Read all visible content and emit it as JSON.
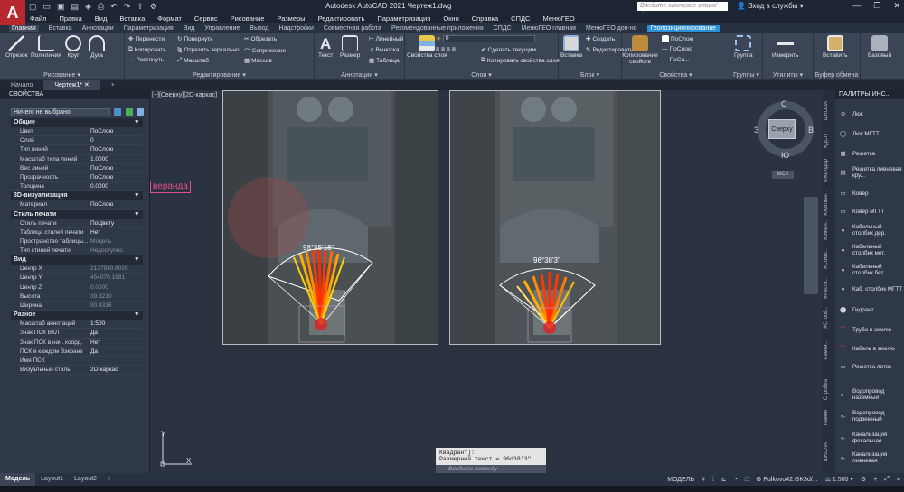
{
  "title_bar": {
    "logo_letter": "A",
    "window_title": "Autodesk AutoCAD 2021   Чертеж1.dwg",
    "search_placeholder": "Введите ключевое слово/фразу",
    "sign_in": "Вход в службы"
  },
  "menu": [
    "Файл",
    "Правка",
    "Вид",
    "Вставка",
    "Формат",
    "Сервис",
    "Рисование",
    "Размеры",
    "Редактировать",
    "Параметризация",
    "Окно",
    "Справка",
    "СПДС",
    "МенюГЕО"
  ],
  "ribbon_tabs": [
    "Главная",
    "Вставка",
    "Аннотации",
    "Параметризация",
    "Вид",
    "Управление",
    "Вывод",
    "Надстройки",
    "Совместная работа",
    "Рекомендованные приложения",
    "СПДС",
    "МенюГЕО главная",
    "МенюГЕО доп-но",
    "Геопозиционирование"
  ],
  "ribbon": {
    "draw": {
      "label": "Рисование",
      "buttons": [
        "Отрезок",
        "Полилиния",
        "Круг",
        "Дуга"
      ]
    },
    "modify": {
      "label": "Редактирование",
      "buttons": [
        "Перенести",
        "Повернуть",
        "Обрезать",
        "Копировать",
        "Отразить зеркально",
        "Сопряжение",
        "Растянуть",
        "Масштаб",
        "Массив"
      ]
    },
    "annotation": {
      "label": "Аннотации",
      "buttons": [
        "Текст",
        "Размер",
        "Линейный",
        "Выноска",
        "Таблица"
      ]
    },
    "layers": {
      "label": "Слои",
      "buttons": [
        "Свойства слоя",
        "Сделать текущим",
        "Копировать свойства слоя"
      ],
      "current_layer": "0"
    },
    "block": {
      "label": "Блок",
      "buttons": [
        "Вставка",
        "Создать",
        "Редактировать"
      ]
    },
    "properties": {
      "label": "Свойства",
      "buttons": [
        "Копирование свойств"
      ],
      "values": [
        "ПоСлою",
        "ПоСлою",
        "ПоСл..."
      ]
    },
    "groups": {
      "label": "Группы",
      "buttons": [
        "Группа"
      ]
    },
    "utilities": {
      "label": "Утилиты",
      "buttons": [
        "Измерить"
      ]
    },
    "clipboard": {
      "label": "Буфер обмена",
      "buttons": [
        "Вставить"
      ]
    },
    "base": {
      "buttons": [
        "Базовый"
      ]
    }
  },
  "file_tabs": [
    "Начало",
    "Чертеж1*"
  ],
  "properties_panel": {
    "title": "СВОЙСТВА",
    "selection": "Ничего не выбрано",
    "sections": [
      {
        "name": "Общие",
        "rows": [
          [
            "Цвет",
            "ПоСлою"
          ],
          [
            "Слой",
            "0"
          ],
          [
            "Тип линий",
            "ПоСлою"
          ],
          [
            "Масштаб типа линий",
            "1.0000"
          ],
          [
            "Вес линий",
            "ПоСлою"
          ],
          [
            "Прозрачность",
            "ПоСлою"
          ],
          [
            "Толщина",
            "0.0000"
          ]
        ]
      },
      {
        "name": "3D-визуализация",
        "rows": [
          [
            "Материал",
            "ПоСлою"
          ]
        ]
      },
      {
        "name": "Стиль печати",
        "rows": [
          [
            "Стиль печати",
            "ПоЦвету"
          ],
          [
            "Таблица стилей печати",
            "Нет"
          ],
          [
            "Пространство таблицы...",
            "Модель"
          ],
          [
            "Тип стилей печати",
            "Недоступно"
          ]
        ]
      },
      {
        "name": "Вид",
        "rows": [
          [
            "Центр X",
            "2137930.8020"
          ],
          [
            "Центр Y",
            "454070.1981"
          ],
          [
            "Центр Z",
            "0.0000"
          ],
          [
            "Высота",
            "39.8210"
          ],
          [
            "Ширина",
            "90.4336"
          ]
        ]
      },
      {
        "name": "Разное",
        "rows": [
          [
            "Масштаб аннотаций",
            "1:500"
          ],
          [
            "Знак ПСК ВКЛ",
            "Да"
          ],
          [
            "Знак ПСК в нач. коорд.",
            "Нет"
          ],
          [
            "ПСК в каждом Вэкране",
            "Да"
          ],
          [
            "Имя ПСК",
            ""
          ],
          [
            "Визуальный стиль",
            "2D-каркас"
          ]
        ]
      }
    ]
  },
  "viewport": {
    "label": "[−][Сверху][2D-каркас]",
    "veranda_label": "веранда",
    "angle_left": "98°55'18\"",
    "angle_right": "96°38'3\"",
    "compass": {
      "n": "С",
      "s": "Ю",
      "w": "З",
      "e": "В",
      "cube": "Сверху",
      "wcs": "МСК"
    },
    "ucs_x": "X",
    "ucs_y": "Y"
  },
  "command_line": {
    "history": [
      "Квадрант]:",
      "Размерный текст = 96d38'3\""
    ],
    "placeholder": "Введите команду"
  },
  "right_vtabs": [
    "ШКОЛА",
    "#ДСП",
    "#Жилдор",
    "#Жилые..",
    "#Эжил..",
    "#Соме..",
    "#Расти..",
    "#Стоой..",
    "Рамки..",
    "Стройка",
    "Рамки",
    "ШКОЛА"
  ],
  "tool_palette": {
    "title": "ПАЛИТРЫ ИНС...",
    "items": [
      "Люк",
      "Люк МГТТ",
      "Решетка",
      "Решетка ливневая кру...",
      "Ковер",
      "Ковер МГТТ",
      "Кабельный столбик дер.",
      "Кабельный столбик мет.",
      "Кабельный столбик бет.",
      "Каб. столбик МГТТ",
      "Гидрант",
      "Труба в землю",
      "Кабель в землю",
      "Решетка лоток",
      "Водопровод наземный",
      "Водопровод подземный",
      "Канализация фекальная",
      "Канализация ливневая"
    ]
  },
  "status_bar": {
    "tabs": [
      "Модель",
      "Layout1",
      "Layout2"
    ],
    "mode": "МОДЕЛЬ",
    "file": "Pulkovo42.GK3d/...",
    "scale": "1:500"
  },
  "colors": {
    "accent": "#2a8fd4",
    "logo": "#b8292f",
    "ribbon": "#3b4556",
    "canvas": "#2b3340",
    "fan_hot": "#ff3a00",
    "fan_warm": "#ffb000",
    "veranda": "#e0508a"
  }
}
